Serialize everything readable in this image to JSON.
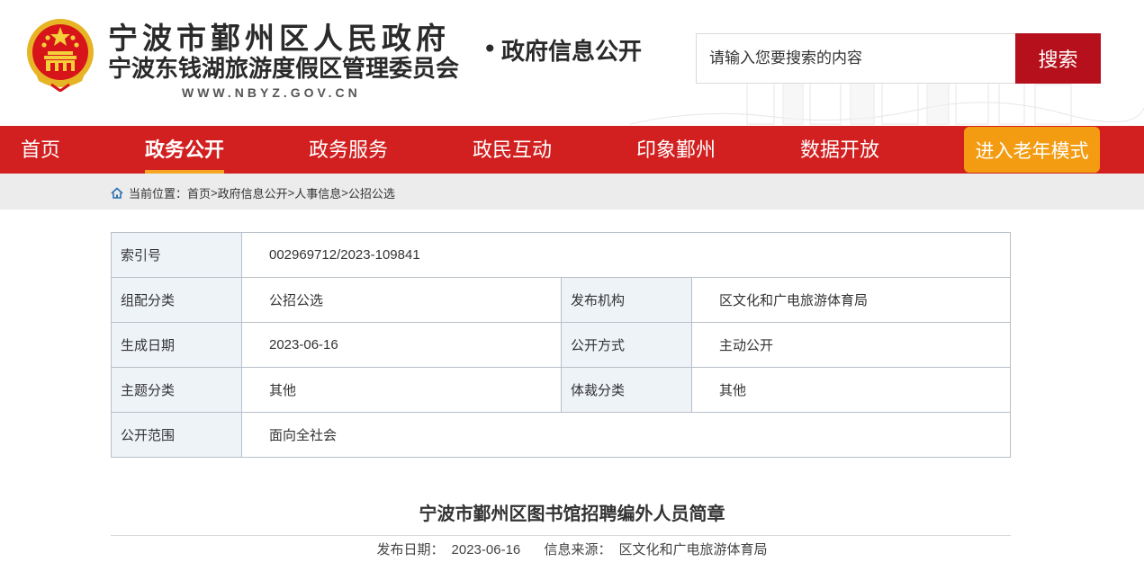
{
  "header": {
    "title_main": "宁波市鄞州区人民政府",
    "title_sub": "宁波东钱湖旅游度假区管理委员会",
    "domain": "WWW.NBYZ.GOV.CN",
    "section_title": "政府信息公开",
    "search": {
      "placeholder": "请输入您要搜索的内容",
      "button": "搜索"
    }
  },
  "nav": {
    "items": [
      {
        "label": "首页"
      },
      {
        "label": "政务公开"
      },
      {
        "label": "政务服务"
      },
      {
        "label": "政民互动"
      },
      {
        "label": "印象鄞州"
      },
      {
        "label": "数据开放"
      }
    ],
    "active_index": 1,
    "elder_mode": "进入老年模式"
  },
  "breadcrumb": {
    "prefix": "当前位置：",
    "items": [
      "首页",
      "政府信息公开",
      "人事信息",
      "公招公选"
    ],
    "separator": ">"
  },
  "info": {
    "index_label": "索引号",
    "index_value": "002969712/2023-109841",
    "category_label": "组配分类",
    "category_value": "公招公选",
    "publisher_label": "发布机构",
    "publisher_value": "区文化和广电旅游体育局",
    "date_label": "生成日期",
    "date_value": "2023-06-16",
    "mode_label": "公开方式",
    "mode_value": "主动公开",
    "topic_label": "主题分类",
    "topic_value": "其他",
    "genre_label": "体裁分类",
    "genre_value": "其他",
    "scope_label": "公开范围",
    "scope_value": "面向全社会"
  },
  "article": {
    "title": "宁波市鄞州区图书馆招聘编外人员简章",
    "publish_date_label": "发布日期：",
    "publish_date": "2023-06-16",
    "source_label": "信息来源：",
    "source": "区文化和广电旅游体育局"
  },
  "colors": {
    "nav_red": "#d21f1f",
    "search_button_red": "#b5101b",
    "elder_orange": "#f39c12",
    "active_underline": "#f5a623",
    "label_cell_bg": "#eef3f8"
  },
  "icons": [
    "national-emblem-icon",
    "home-icon"
  ]
}
